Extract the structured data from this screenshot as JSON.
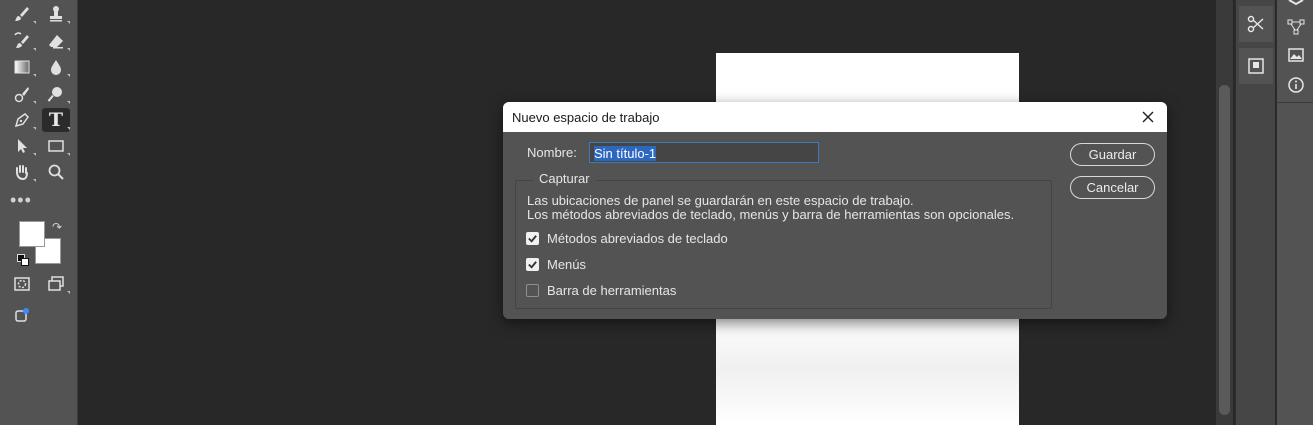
{
  "toolbar": {
    "tools": [
      {
        "name": "brush-tool-icon"
      },
      {
        "name": "clone-stamp-tool-icon"
      },
      {
        "name": "history-brush-tool-icon"
      },
      {
        "name": "eraser-tool-icon"
      },
      {
        "name": "gradient-tool-icon"
      },
      {
        "name": "blur-tool-icon"
      },
      {
        "name": "content-aware-brush-icon"
      },
      {
        "name": "dodge-tool-icon"
      },
      {
        "name": "pen-tool-icon"
      },
      {
        "name": "type-tool-icon",
        "glyph": "T"
      },
      {
        "name": "path-selection-tool-icon"
      },
      {
        "name": "rectangle-tool-icon"
      },
      {
        "name": "hand-tool-icon"
      },
      {
        "name": "zoom-tool-icon"
      }
    ],
    "more_label": "•••",
    "foreground_color": "#ffffff",
    "background_color": "#ffffff"
  },
  "dialog": {
    "title": "Nuevo espacio de trabajo",
    "name_label": "Nombre:",
    "name_value": "Sin título-1",
    "save_button": "Guardar",
    "cancel_button": "Cancelar",
    "group_title": "Capturar",
    "description_line1": "Las ubicaciones de panel se guardarán en este espacio de trabajo.",
    "description_line2": "Los métodos abreviados de teclado, menús y barra de herramientas son opcionales.",
    "options": [
      {
        "label": "Métodos abreviados de teclado",
        "checked": true
      },
      {
        "label": "Menús",
        "checked": true
      },
      {
        "label": "Barra de herramientas",
        "checked": false
      }
    ]
  },
  "colors": {
    "app_background": "#282828",
    "panel": "#535353",
    "accent": "#2c67c0"
  }
}
